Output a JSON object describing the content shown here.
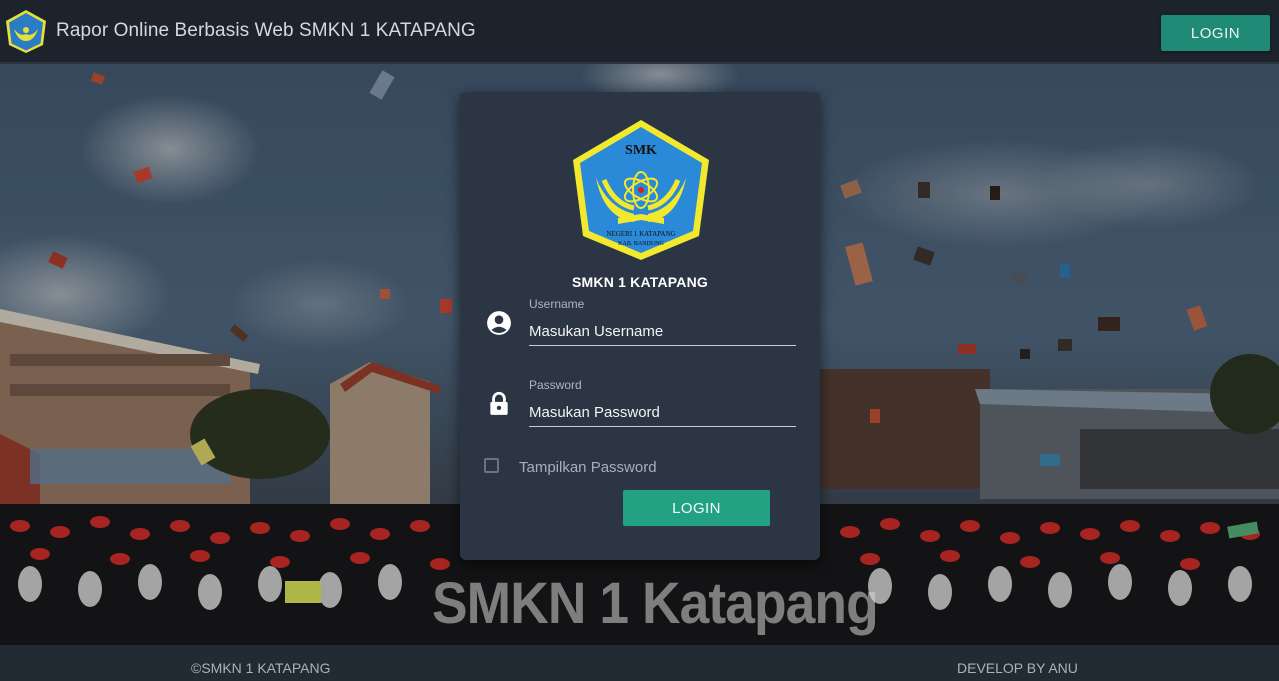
{
  "header": {
    "title": "Rapor Online Berbasis Web SMKN 1 KATAPANG",
    "login_label": "LOGIN",
    "logo_icon": "school-emblem-icon"
  },
  "background": {
    "watermark_text": "SMKN 1 Katapang"
  },
  "card": {
    "logo_text_top": "SMK",
    "logo_text_ring": "NEGERI 1 KATAPANG",
    "logo_text_ring2": "KAB. BANDUNG",
    "school_name": "SMKN 1 KATAPANG",
    "username": {
      "label": "Username",
      "placeholder": "Masukan Username",
      "value": "",
      "icon": "user-circle-icon"
    },
    "password": {
      "label": "Password",
      "placeholder": "Masukan Password",
      "value": "",
      "icon": "lock-icon"
    },
    "show_password_label": "Tampilkan Password",
    "show_password_checked": false,
    "login_label": "LOGIN"
  },
  "footer": {
    "left_text": "©SMKN 1 KATAPANG",
    "right_text": "DEVELOP BY ANU"
  },
  "colors": {
    "header_bg": "#1d232c",
    "card_bg": "#2b3544",
    "accent": "#23a283",
    "header_button": "#1f8a75"
  }
}
